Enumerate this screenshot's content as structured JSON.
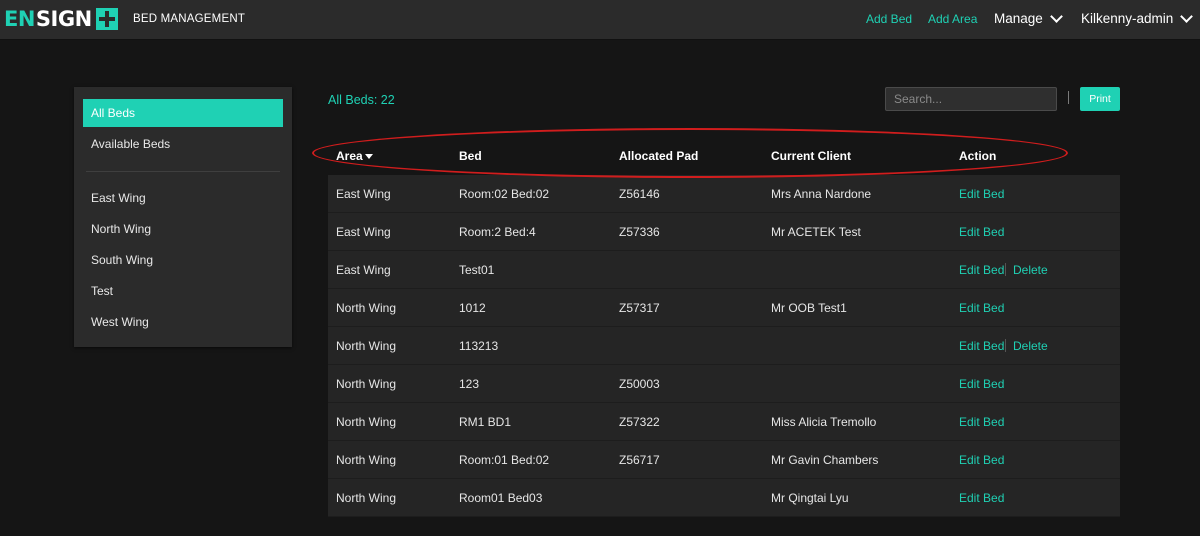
{
  "header": {
    "logo_part1": "EN",
    "logo_part2": "SIGN",
    "app_title": "BED MANAGEMENT",
    "add_bed": "Add Bed",
    "add_area": "Add Area",
    "manage": "Manage",
    "user": "Kilkenny-admin"
  },
  "sidebar": {
    "top_items": [
      "All Beds",
      "Available Beds"
    ],
    "areas": [
      "East Wing",
      "North Wing",
      "South Wing",
      "Test",
      "West Wing"
    ]
  },
  "main": {
    "count_label": "All Beds: 22",
    "search_placeholder": "Search...",
    "print_label": "Print"
  },
  "table": {
    "columns": [
      "Area",
      "Bed",
      "Allocated Pad",
      "Current Client",
      "Action"
    ],
    "rows": [
      {
        "area": "East Wing",
        "bed": "Room:02 Bed:02",
        "pad": "Z56146",
        "client": "Mrs Anna Nardone",
        "actions": [
          "Edit Bed"
        ]
      },
      {
        "area": "East Wing",
        "bed": "Room:2 Bed:4",
        "pad": "Z57336",
        "client": "Mr ACETEK Test",
        "actions": [
          "Edit Bed"
        ]
      },
      {
        "area": "East Wing",
        "bed": "Test01",
        "pad": "",
        "client": "",
        "actions": [
          "Edit Bed",
          "Delete"
        ]
      },
      {
        "area": "North Wing",
        "bed": "1012",
        "pad": "Z57317",
        "client": "Mr OOB Test1",
        "actions": [
          "Edit Bed"
        ]
      },
      {
        "area": "North Wing",
        "bed": "113213",
        "pad": "",
        "client": "",
        "actions": [
          "Edit Bed",
          "Delete"
        ]
      },
      {
        "area": "North Wing",
        "bed": "123",
        "pad": "Z50003",
        "client": "",
        "actions": [
          "Edit Bed"
        ]
      },
      {
        "area": "North Wing",
        "bed": "RM1 BD1",
        "pad": "Z57322",
        "client": "Miss Alicia Tremollo",
        "actions": [
          "Edit Bed"
        ]
      },
      {
        "area": "North Wing",
        "bed": "Room:01 Bed:02",
        "pad": "Z56717",
        "client": "Mr Gavin Chambers",
        "actions": [
          "Edit Bed"
        ]
      },
      {
        "area": "North Wing",
        "bed": "Room01 Bed03",
        "pad": "",
        "client": "Mr Qingtai Lyu",
        "actions": [
          "Edit Bed"
        ]
      }
    ]
  },
  "colors": {
    "accent": "#1fd1b4",
    "highlight": "#d11d1d",
    "topbar": "#2b2b2b",
    "background": "#151515"
  }
}
